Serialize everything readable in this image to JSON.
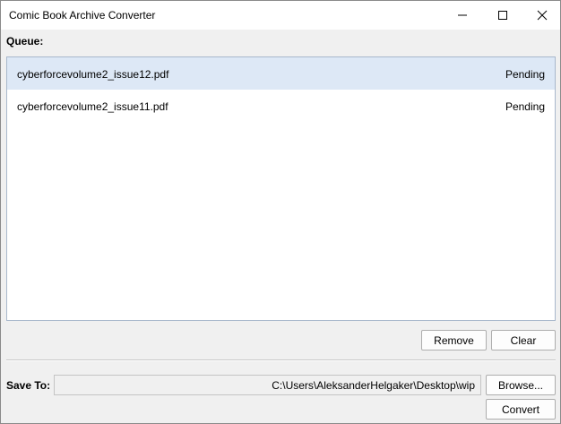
{
  "window": {
    "title": "Comic Book Archive Converter"
  },
  "queue": {
    "label": "Queue:",
    "items": [
      {
        "name": "cyberforcevolume2_issue12.pdf",
        "status": "Pending"
      },
      {
        "name": "cyberforcevolume2_issue11.pdf",
        "status": "Pending"
      }
    ]
  },
  "actions": {
    "remove_label": "Remove",
    "clear_label": "Clear"
  },
  "save": {
    "label": "Save To:",
    "path": "C:\\Users\\AleksanderHelgaker\\Desktop\\wip",
    "browse_label": "Browse...",
    "convert_label": "Convert"
  },
  "colors": {
    "selected_row": "#dde8f6",
    "list_border": "#a8b8cc"
  },
  "icons": [
    "minimize-icon",
    "maximize-icon",
    "close-icon"
  ]
}
